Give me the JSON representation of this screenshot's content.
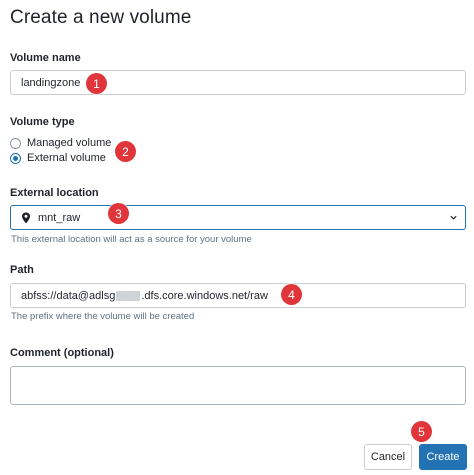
{
  "dialog": {
    "title": "Create a new volume"
  },
  "volume_name": {
    "label": "Volume name",
    "value": "landingzone"
  },
  "volume_type": {
    "label": "Volume type",
    "options": [
      {
        "label": "Managed volume",
        "selected": false
      },
      {
        "label": "External volume",
        "selected": true
      }
    ]
  },
  "external_location": {
    "label": "External location",
    "value": "mnt_raw",
    "hint": "This external location will act as a source for your volume",
    "icon": "location-pin-icon"
  },
  "path": {
    "label": "Path",
    "value_prefix": "abfss://data@adlsg",
    "value_suffix": ".dfs.core.windows.net/raw",
    "hint": "The prefix where the volume will be created"
  },
  "comment": {
    "label": "Comment (optional)",
    "value": ""
  },
  "buttons": {
    "cancel": "Cancel",
    "create": "Create"
  },
  "annotations": [
    "1",
    "2",
    "3",
    "4",
    "5"
  ],
  "colors": {
    "accent": "#2272b4",
    "badge": "#e0353a",
    "hint": "#5f7281"
  }
}
